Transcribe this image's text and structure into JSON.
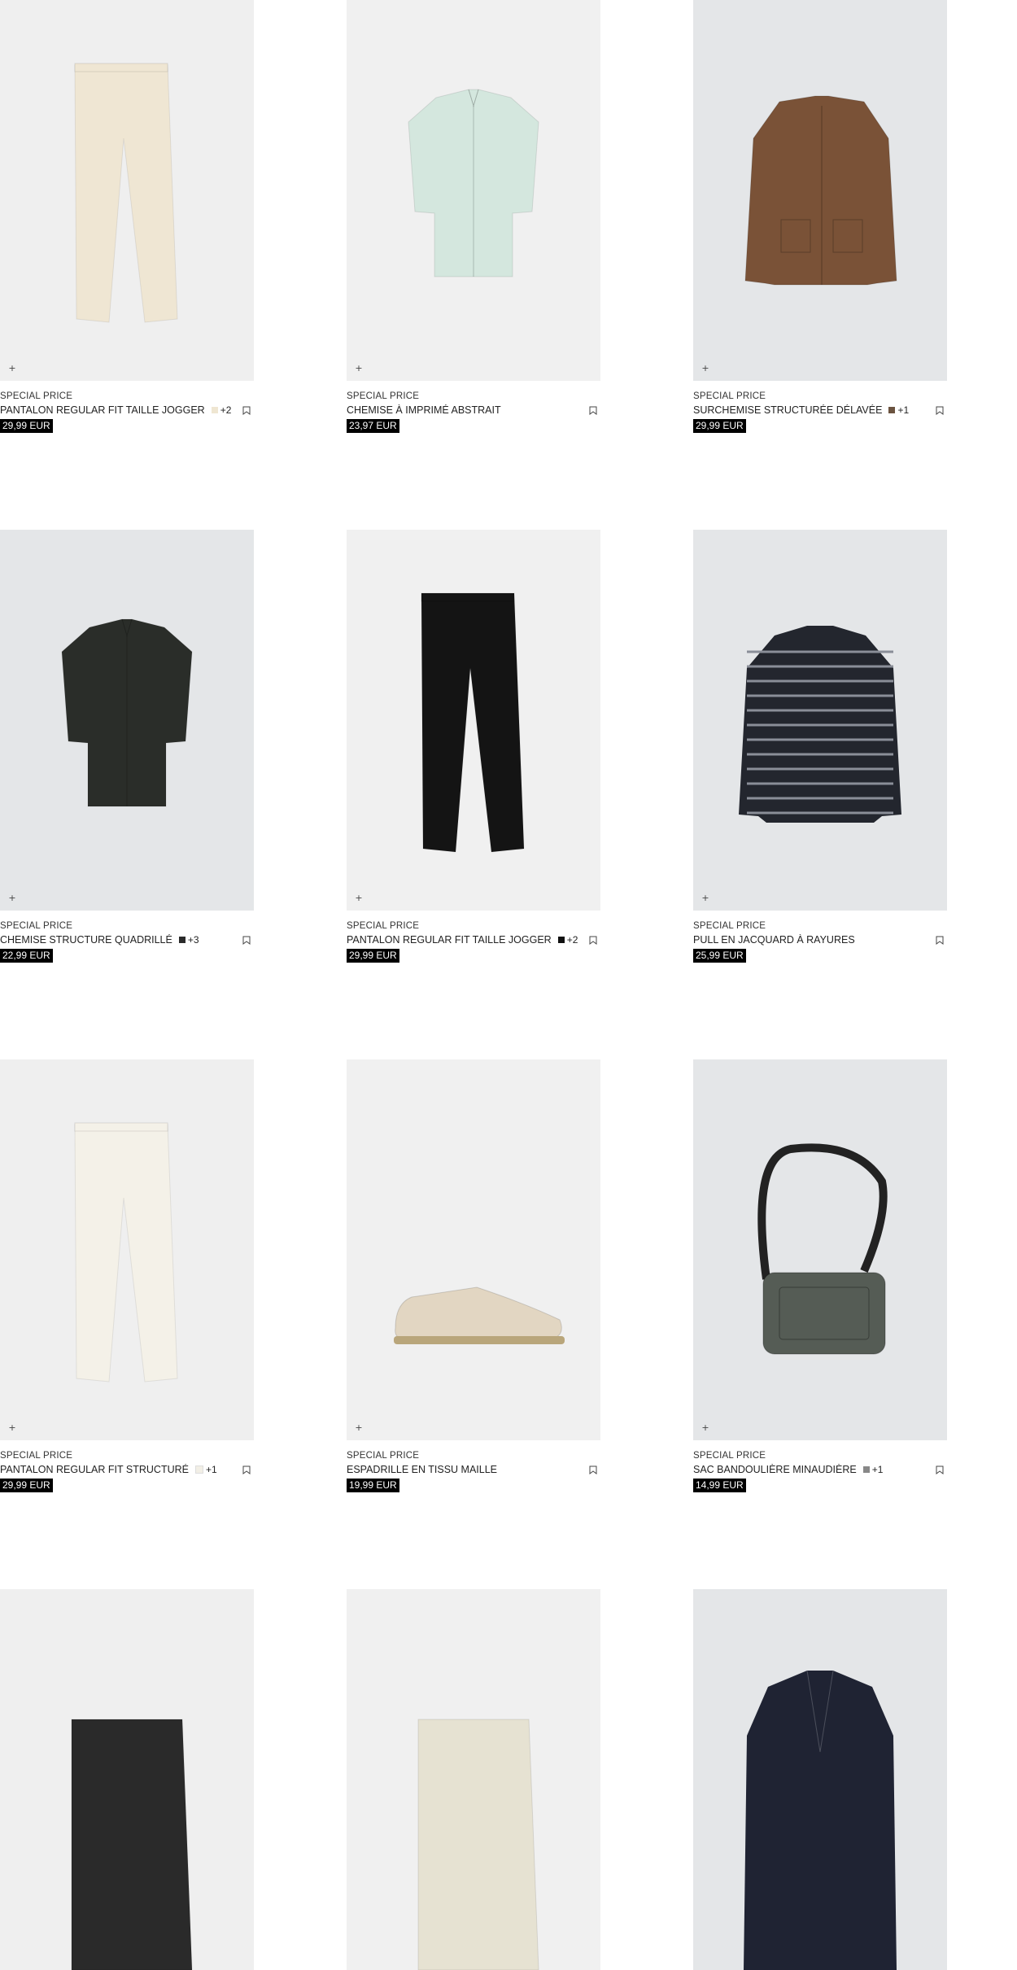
{
  "products": [
    {
      "tag": "SPECIAL PRICE",
      "name": "PANTALON REGULAR FIT TAILLE JOGGER",
      "swatch": "#efe6d2",
      "more": "+2",
      "price": "29,99 EUR",
      "bg": "#efefef",
      "icon": "trousers-icon",
      "color": "#efe6d3"
    },
    {
      "tag": "SPECIAL PRICE",
      "name": "CHEMISE À IMPRIMÉ ABSTRAIT",
      "swatch": "",
      "more": "",
      "price": "23,97 EUR",
      "bg": "#f0f0f0",
      "icon": "shirt-icon",
      "color": "#d4e7de"
    },
    {
      "tag": "SPECIAL PRICE",
      "name": "SURCHEMISE STRUCTURÉE DÉLAVÉE",
      "swatch": "#6b5340",
      "more": "+1",
      "price": "29,99 EUR",
      "bg": "#e4e6e8",
      "icon": "jacket-icon",
      "color": "#7a5237"
    },
    {
      "tag": "SPECIAL PRICE",
      "name": "CHEMISE STRUCTURE QUADRILLÉ",
      "swatch": "#2a2a2a",
      "more": "+3",
      "price": "22,99 EUR",
      "bg": "#e4e6e8",
      "icon": "shirt-icon",
      "color": "#2a2d29"
    },
    {
      "tag": "SPECIAL PRICE",
      "name": "PANTALON REGULAR FIT TAILLE JOGGER",
      "swatch": "#111111",
      "more": "+2",
      "price": "29,99 EUR",
      "bg": "#f0f0f0",
      "icon": "trousers-icon",
      "color": "#141414"
    },
    {
      "tag": "SPECIAL PRICE",
      "name": "PULL EN JACQUARD À RAYURES",
      "swatch": "",
      "more": "",
      "price": "25,99 EUR",
      "bg": "#e4e6e8",
      "icon": "sweater-icon",
      "color": "#23262e"
    },
    {
      "tag": "SPECIAL PRICE",
      "name": "PANTALON REGULAR FIT STRUCTURÉ",
      "swatch": "#f2efe6",
      "more": "+1",
      "price": "29,99 EUR",
      "bg": "#efefef",
      "icon": "trousers-icon",
      "color": "#f4f1e8"
    },
    {
      "tag": "SPECIAL PRICE",
      "name": "ESPADRILLE EN TISSU MAILLE",
      "swatch": "",
      "more": "",
      "price": "19,99 EUR",
      "bg": "#f0f0f0",
      "icon": "shoe-icon",
      "color": "#e2d6c2"
    },
    {
      "tag": "SPECIAL PRICE",
      "name": "SAC BANDOULIÈRE MINAUDIÈRE",
      "swatch": "#888888",
      "more": "+1",
      "price": "14,99 EUR",
      "bg": "#e4e6e8",
      "icon": "bag-icon",
      "color": "#555c55"
    },
    {
      "tag": "",
      "name": "",
      "swatch": "",
      "more": "",
      "price": "",
      "bg": "#efefef",
      "icon": "shorts-icon",
      "color": "#2a2a2a"
    },
    {
      "tag": "",
      "name": "",
      "swatch": "",
      "more": "",
      "price": "",
      "bg": "#f0f0f0",
      "icon": "shorts-icon",
      "color": "#e6e2d2"
    },
    {
      "tag": "",
      "name": "",
      "swatch": "",
      "more": "",
      "price": "",
      "bg": "#e4e6e8",
      "icon": "blazer-icon",
      "color": "#1f2333"
    }
  ],
  "plus_glyph": "+"
}
